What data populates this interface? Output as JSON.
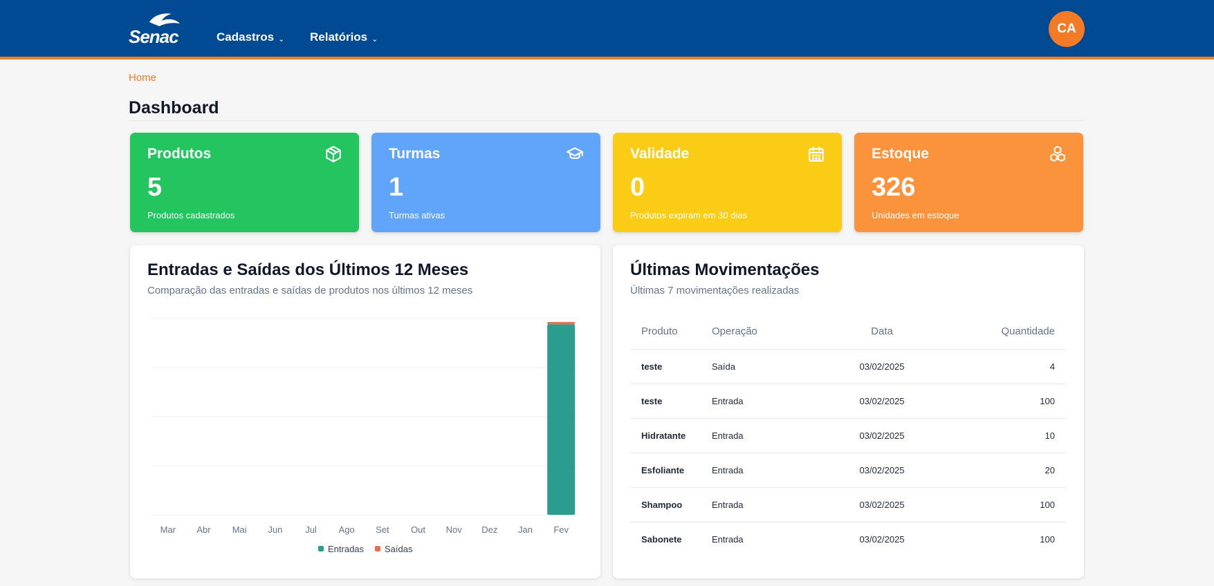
{
  "header": {
    "logo_text": "Senac",
    "nav": [
      {
        "label": "Cadastros"
      },
      {
        "label": "Relatórios"
      }
    ],
    "avatar_initials": "CA",
    "colors": {
      "bar": "#004a93",
      "accent": "#f47b25"
    }
  },
  "breadcrumb": {
    "home": "Home"
  },
  "page": {
    "title": "Dashboard"
  },
  "cards": [
    {
      "title": "Produtos",
      "value": "5",
      "desc": "Produtos cadastrados",
      "icon": "box-icon",
      "color": "#22c55e"
    },
    {
      "title": "Turmas",
      "value": "1",
      "desc": "Turmas ativas",
      "icon": "graduation-cap-icon",
      "color": "#60a5fa"
    },
    {
      "title": "Validade",
      "value": "0",
      "desc": "Produtos expiram em 30 dias",
      "icon": "calendar-icon",
      "color": "#facc15"
    },
    {
      "title": "Estoque",
      "value": "326",
      "desc": "Unidades em estoque",
      "icon": "boxes-icon",
      "color": "#fb923c"
    }
  ],
  "chart_panel": {
    "title": "Entradas e Saídas dos Últimos 12 Meses",
    "subtitle": "Comparação das entradas e saídas de produtos nos últimos 12 meses"
  },
  "chart_data": {
    "type": "bar",
    "stacked": true,
    "categories": [
      "Mar",
      "Abr",
      "Mai",
      "Jun",
      "Jul",
      "Ago",
      "Set",
      "Out",
      "Nov",
      "Dez",
      "Jan",
      "Fev"
    ],
    "series": [
      {
        "name": "Entradas",
        "color": "#2a9d8f",
        "values": [
          0,
          0,
          0,
          0,
          0,
          0,
          0,
          0,
          0,
          0,
          0,
          330
        ]
      },
      {
        "name": "Saídas",
        "color": "#e76f51",
        "values": [
          0,
          0,
          0,
          0,
          0,
          0,
          0,
          0,
          0,
          0,
          0,
          4
        ]
      }
    ],
    "ylim": [
      0,
      340
    ],
    "grid": true,
    "legend": "bottom"
  },
  "table_panel": {
    "title": "Últimas Movimentações",
    "subtitle": "Últimas 7 movimentações realizadas",
    "columns": [
      "Produto",
      "Operação",
      "Data",
      "Quantidade"
    ],
    "rows": [
      {
        "produto": "teste",
        "operacao": "Saída",
        "data": "03/02/2025",
        "quantidade": "4"
      },
      {
        "produto": "teste",
        "operacao": "Entrada",
        "data": "03/02/2025",
        "quantidade": "100"
      },
      {
        "produto": "Hidratante",
        "operacao": "Entrada",
        "data": "03/02/2025",
        "quantidade": "10"
      },
      {
        "produto": "Esfoliante",
        "operacao": "Entrada",
        "data": "03/02/2025",
        "quantidade": "20"
      },
      {
        "produto": "Shampoo",
        "operacao": "Entrada",
        "data": "03/02/2025",
        "quantidade": "100"
      },
      {
        "produto": "Sabonete",
        "operacao": "Entrada",
        "data": "03/02/2025",
        "quantidade": "100"
      }
    ]
  }
}
